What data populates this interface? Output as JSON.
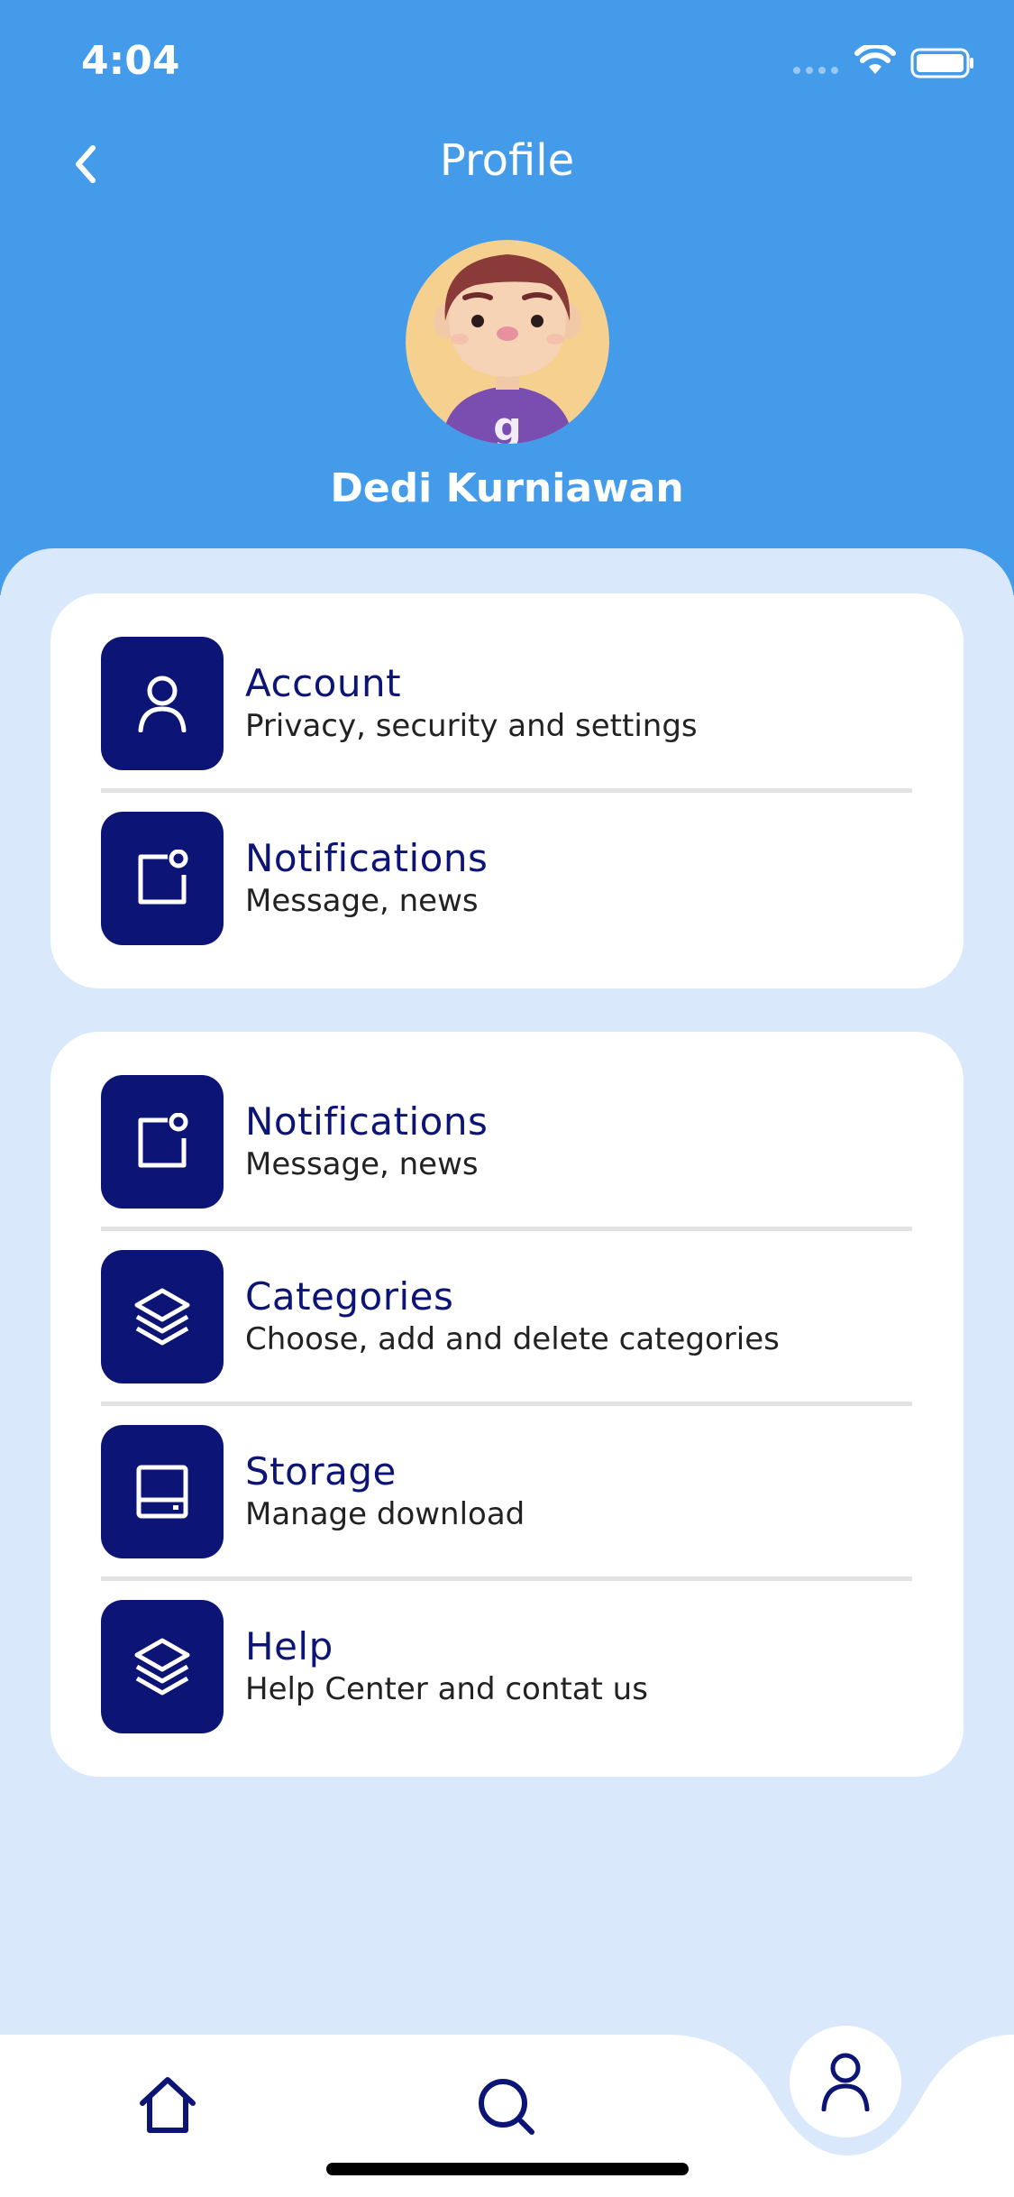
{
  "status_bar": {
    "time": "4:04"
  },
  "header": {
    "title": "Profile",
    "user_name": "Dedi Kurniawan",
    "back_icon": "chevron-left-icon"
  },
  "cards": [
    {
      "items": [
        {
          "icon": "user-icon",
          "title": "Account",
          "subtitle": "Privacy, security and settings"
        },
        {
          "icon": "notification-icon",
          "title": "Notifications",
          "subtitle": "Message, news"
        }
      ]
    },
    {
      "items": [
        {
          "icon": "notification-icon",
          "title": "Notifications",
          "subtitle": "Message, news"
        },
        {
          "icon": "layers-icon",
          "title": "Categories",
          "subtitle": "Choose, add and delete categories"
        },
        {
          "icon": "storage-icon",
          "title": "Storage",
          "subtitle": "Manage download"
        },
        {
          "icon": "layers-icon",
          "title": "Help",
          "subtitle": "Help Center and contat us"
        }
      ]
    }
  ],
  "bottom_nav": {
    "tabs": [
      {
        "name": "home",
        "icon": "home-icon",
        "active": false
      },
      {
        "name": "search",
        "icon": "search-icon",
        "active": false
      },
      {
        "name": "profile",
        "icon": "user-icon",
        "active": true
      }
    ]
  },
  "colors": {
    "header_bg": "#449BEA",
    "page_bg": "#D9E9FB",
    "accent": "#0C1575",
    "card_bg": "#FFFFFF"
  }
}
